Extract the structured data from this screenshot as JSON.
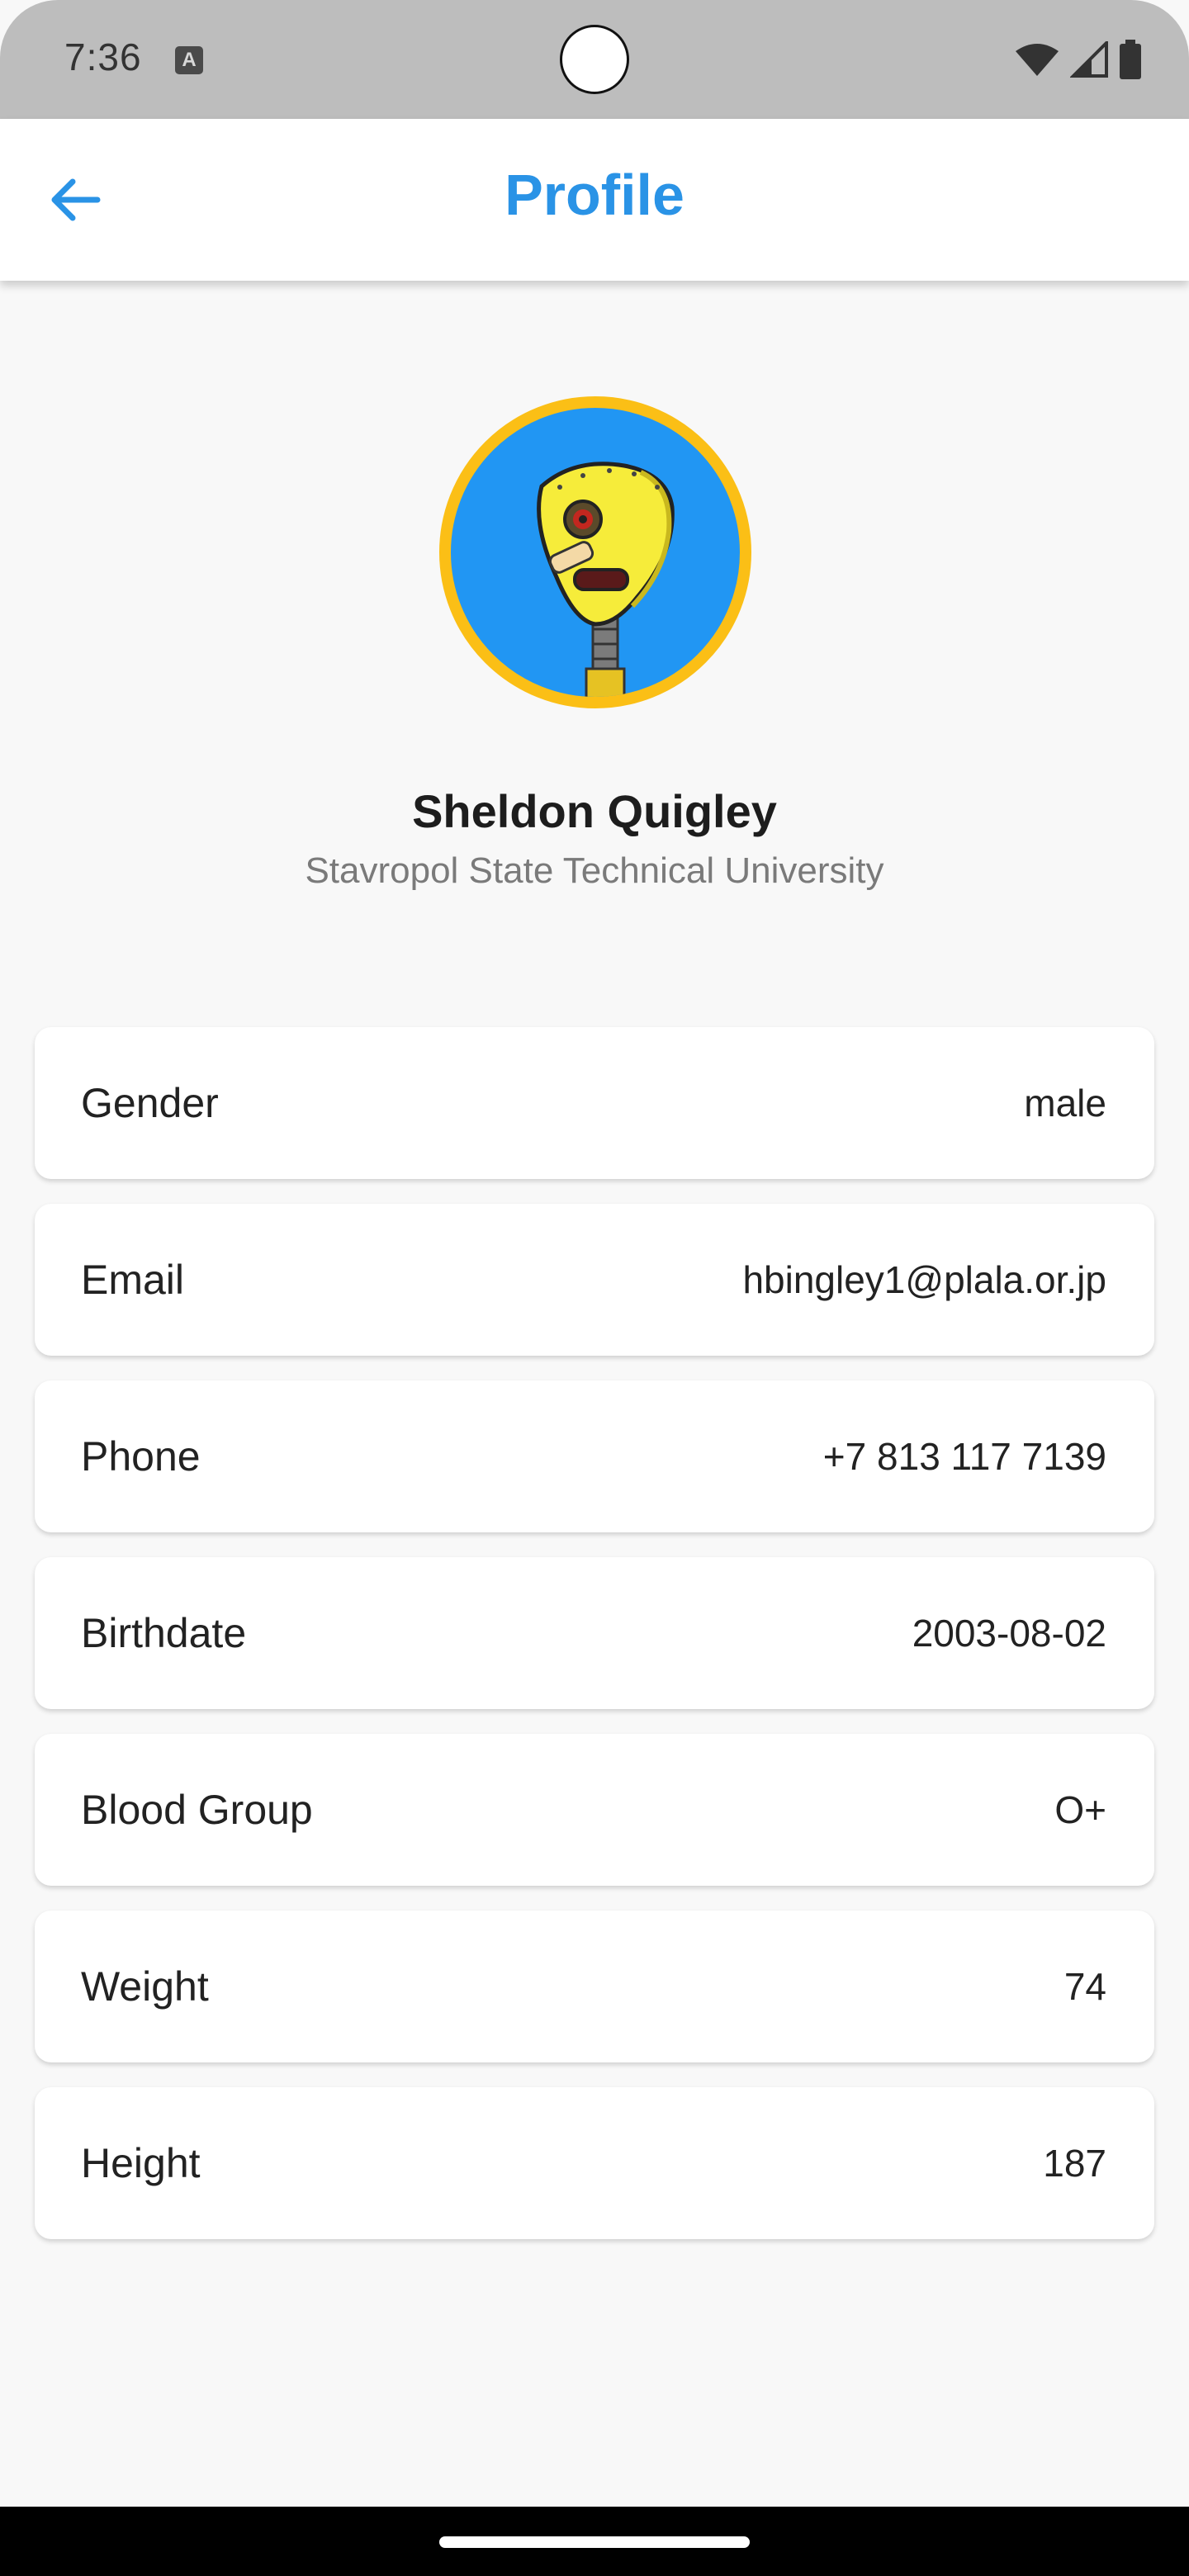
{
  "status_bar": {
    "time": "7:36",
    "notification_icon_letter": "A",
    "icons": [
      "wifi-icon",
      "signal-icon",
      "battery-icon"
    ]
  },
  "app_bar": {
    "title": "Profile",
    "back_icon": "arrow-left-icon",
    "accent_color": "#2a93e6"
  },
  "profile": {
    "name": "Sheldon Quigley",
    "university": "Stavropol State Technical University",
    "avatar": {
      "icon": "robot-avatar",
      "background_color": "#2196f3",
      "border_color": "#fbbf16"
    }
  },
  "info": [
    {
      "label": "Gender",
      "value": "male"
    },
    {
      "label": "Email",
      "value": "hbingley1@plala.or.jp"
    },
    {
      "label": "Phone",
      "value": "+7 813 117 7139"
    },
    {
      "label": "Birthdate",
      "value": "2003-08-02"
    },
    {
      "label": "Blood Group",
      "value": "O+"
    },
    {
      "label": "Weight",
      "value": "74"
    },
    {
      "label": "Height",
      "value": "187"
    }
  ]
}
